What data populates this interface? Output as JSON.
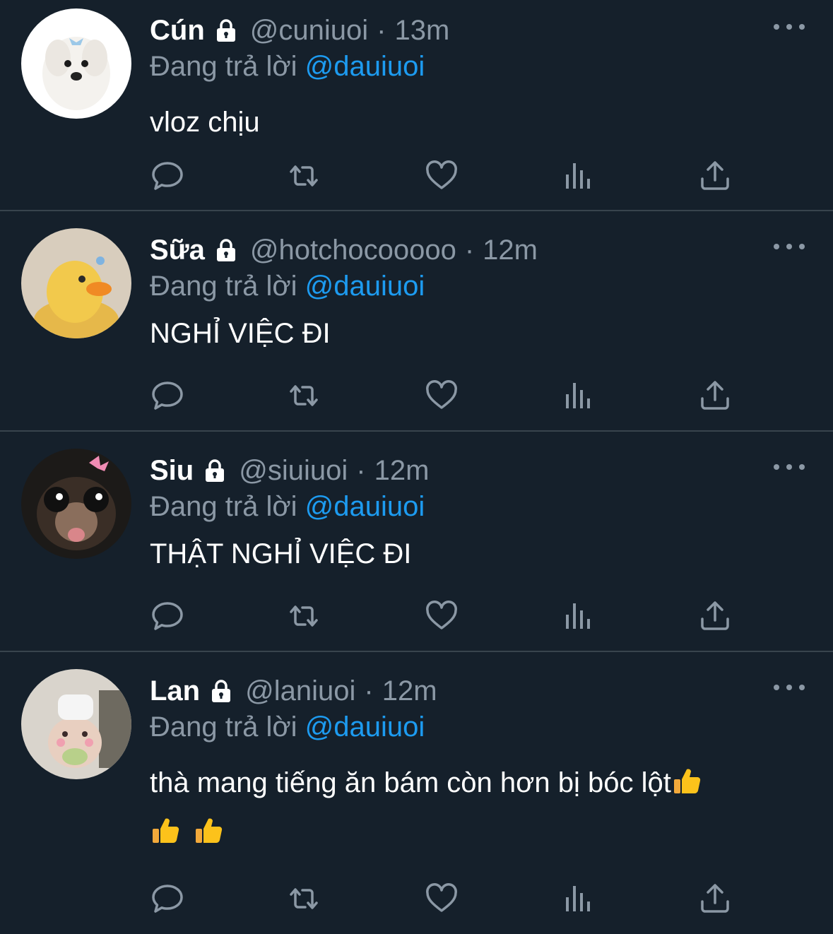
{
  "reply_prefix": "Đang trả lời",
  "colors": {
    "background": "#15202b",
    "divider": "#38444d",
    "secondary_text": "#8b98a5",
    "mention": "#1d9bf0",
    "primary_text": "#ffffff"
  },
  "icons": {
    "lock": "lock-icon",
    "more": "more-icon",
    "reply": "reply-icon",
    "retweet": "retweet-icon",
    "like": "heart-icon",
    "views": "views-icon",
    "share": "share-icon"
  },
  "tweets": [
    {
      "name": "Cún",
      "handle": "@cuniuoi",
      "separator": "·",
      "time": "13m",
      "reply_to": "@dauiuoi",
      "text": "vloz chịu",
      "avatar": "white-puppy"
    },
    {
      "name": "Sữa",
      "handle": "@hotchocooooo",
      "separator": "·",
      "time": "12m",
      "reply_to": "@dauiuoi",
      "text": "NGHỈ VIỆC ĐI",
      "avatar": "yellow-duck"
    },
    {
      "name": "Siu",
      "handle": "@siuiuoi",
      "separator": "·",
      "time": "12m",
      "reply_to": "@dauiuoi",
      "text": "THẬT NGHỈ VIỆC ĐI",
      "avatar": "monkey-with-bow"
    },
    {
      "name": "Lan",
      "handle": "@laniuoi",
      "separator": "·",
      "time": "12m",
      "reply_to": "@dauiuoi",
      "text": "thà mang tiếng ăn bám còn hơn bị bóc lột",
      "emoji": "thumbs-up",
      "emoji_count": 3,
      "avatar": "hamster-with-hat"
    }
  ]
}
